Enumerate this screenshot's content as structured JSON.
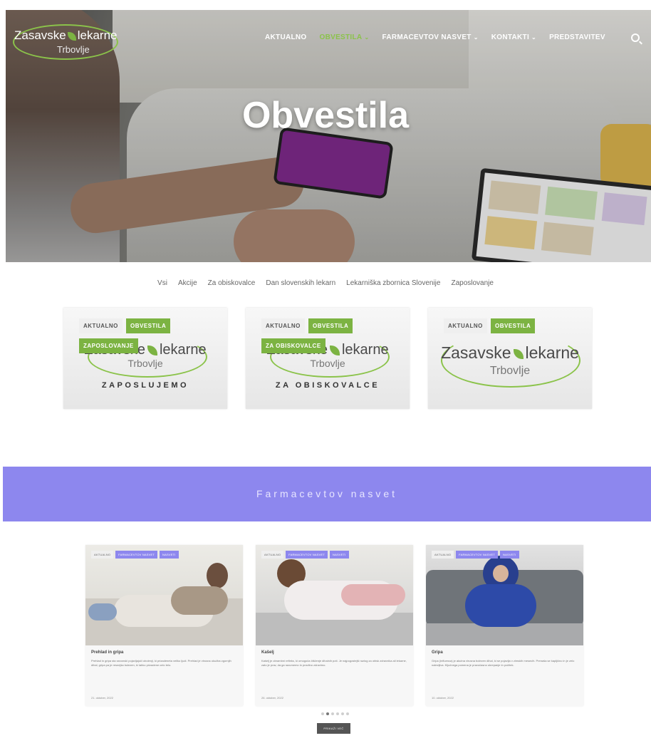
{
  "brand": {
    "name_left": "Zasavske",
    "name_right": "lekarne",
    "sub": "Trbovlje",
    "accent": "#8bc34a",
    "banner_color": "#8d87ee"
  },
  "nav": {
    "items": [
      {
        "label": "AKTUALNO",
        "active": false,
        "chevron": ""
      },
      {
        "label": "OBVESTILA",
        "active": true,
        "chevron": "⌄"
      },
      {
        "label": "FARMACEVTOV NASVET",
        "active": false,
        "chevron": "⌄"
      },
      {
        "label": "KONTAKTI",
        "active": false,
        "chevron": "⌄"
      },
      {
        "label": "PREDSTAVITEV",
        "active": false,
        "chevron": ""
      }
    ],
    "search_icon": "search-icon"
  },
  "hero": {
    "title": "Obvestila"
  },
  "filters": [
    "Vsi",
    "Akcije",
    "Za obiskovalce",
    "Dan slovenskih lekarn",
    "Lekarniška zbornica Slovenije",
    "Zaposlovanje"
  ],
  "cards": [
    {
      "tag1": "AKTUALNO",
      "tag2": "OBVESTILA",
      "tag3": "ZAPOSLOVANJE",
      "caption": "ZAPOSLUJEMO"
    },
    {
      "tag1": "AKTUALNO",
      "tag2": "OBVESTILA",
      "tag3": "ZA OBISKOVALCE",
      "caption": "ZA OBISKOVALCE"
    },
    {
      "tag1": "AKTUALNO",
      "tag2": "OBVESTILA",
      "tag3": "",
      "caption": ""
    }
  ],
  "banner": {
    "title": "Farmacevtov nasvet"
  },
  "articles": [
    {
      "tag1": "AKTUALNO",
      "tag2": "FARMACEVTOV NASVET",
      "tag3": "NASVETI",
      "title": "Prehlad in gripa",
      "text": "Prehlad in gripa sta sezonski pojavljajoči obolenji, ki prizadeneta veliko ljudi. Prehlad je virusna okužba zgornjih dihal, gripa pa je resnejša bolezen, ki lahko prizadene celo telo.",
      "date": "21. oktober, 2022"
    },
    {
      "tag1": "AKTUALNO",
      "tag2": "FARMACEVTOV NASVET",
      "tag3": "NASVETI",
      "title": "Kašelj",
      "text": "Kašelj je obrambni refleks, ki omogoča čiščenje dihalnih poti. Je najpogostejši razlog za obisk zdravnika ali lekarne, zato je prav, da ga razumemo in pravilno zdravimo.",
      "date": "26. oktober, 2022"
    },
    {
      "tag1": "AKTUALNO",
      "tag2": "FARMACEVTOV NASVET",
      "tag3": "NASVETI",
      "title": "Gripa",
      "text": "Gripa (influenca) je akutna virusna bolezen dihal, ki se pojavlja v zimskih mesecih. Prenaša se kapljično in je zelo nalezljiva. Ključnega pomena je pravočasno ukrepanje in počitek.",
      "date": "10. oktober, 2022"
    }
  ],
  "pager": {
    "dots": 6,
    "active": 1
  },
  "more_button": "PRIKAŽI VEČ"
}
